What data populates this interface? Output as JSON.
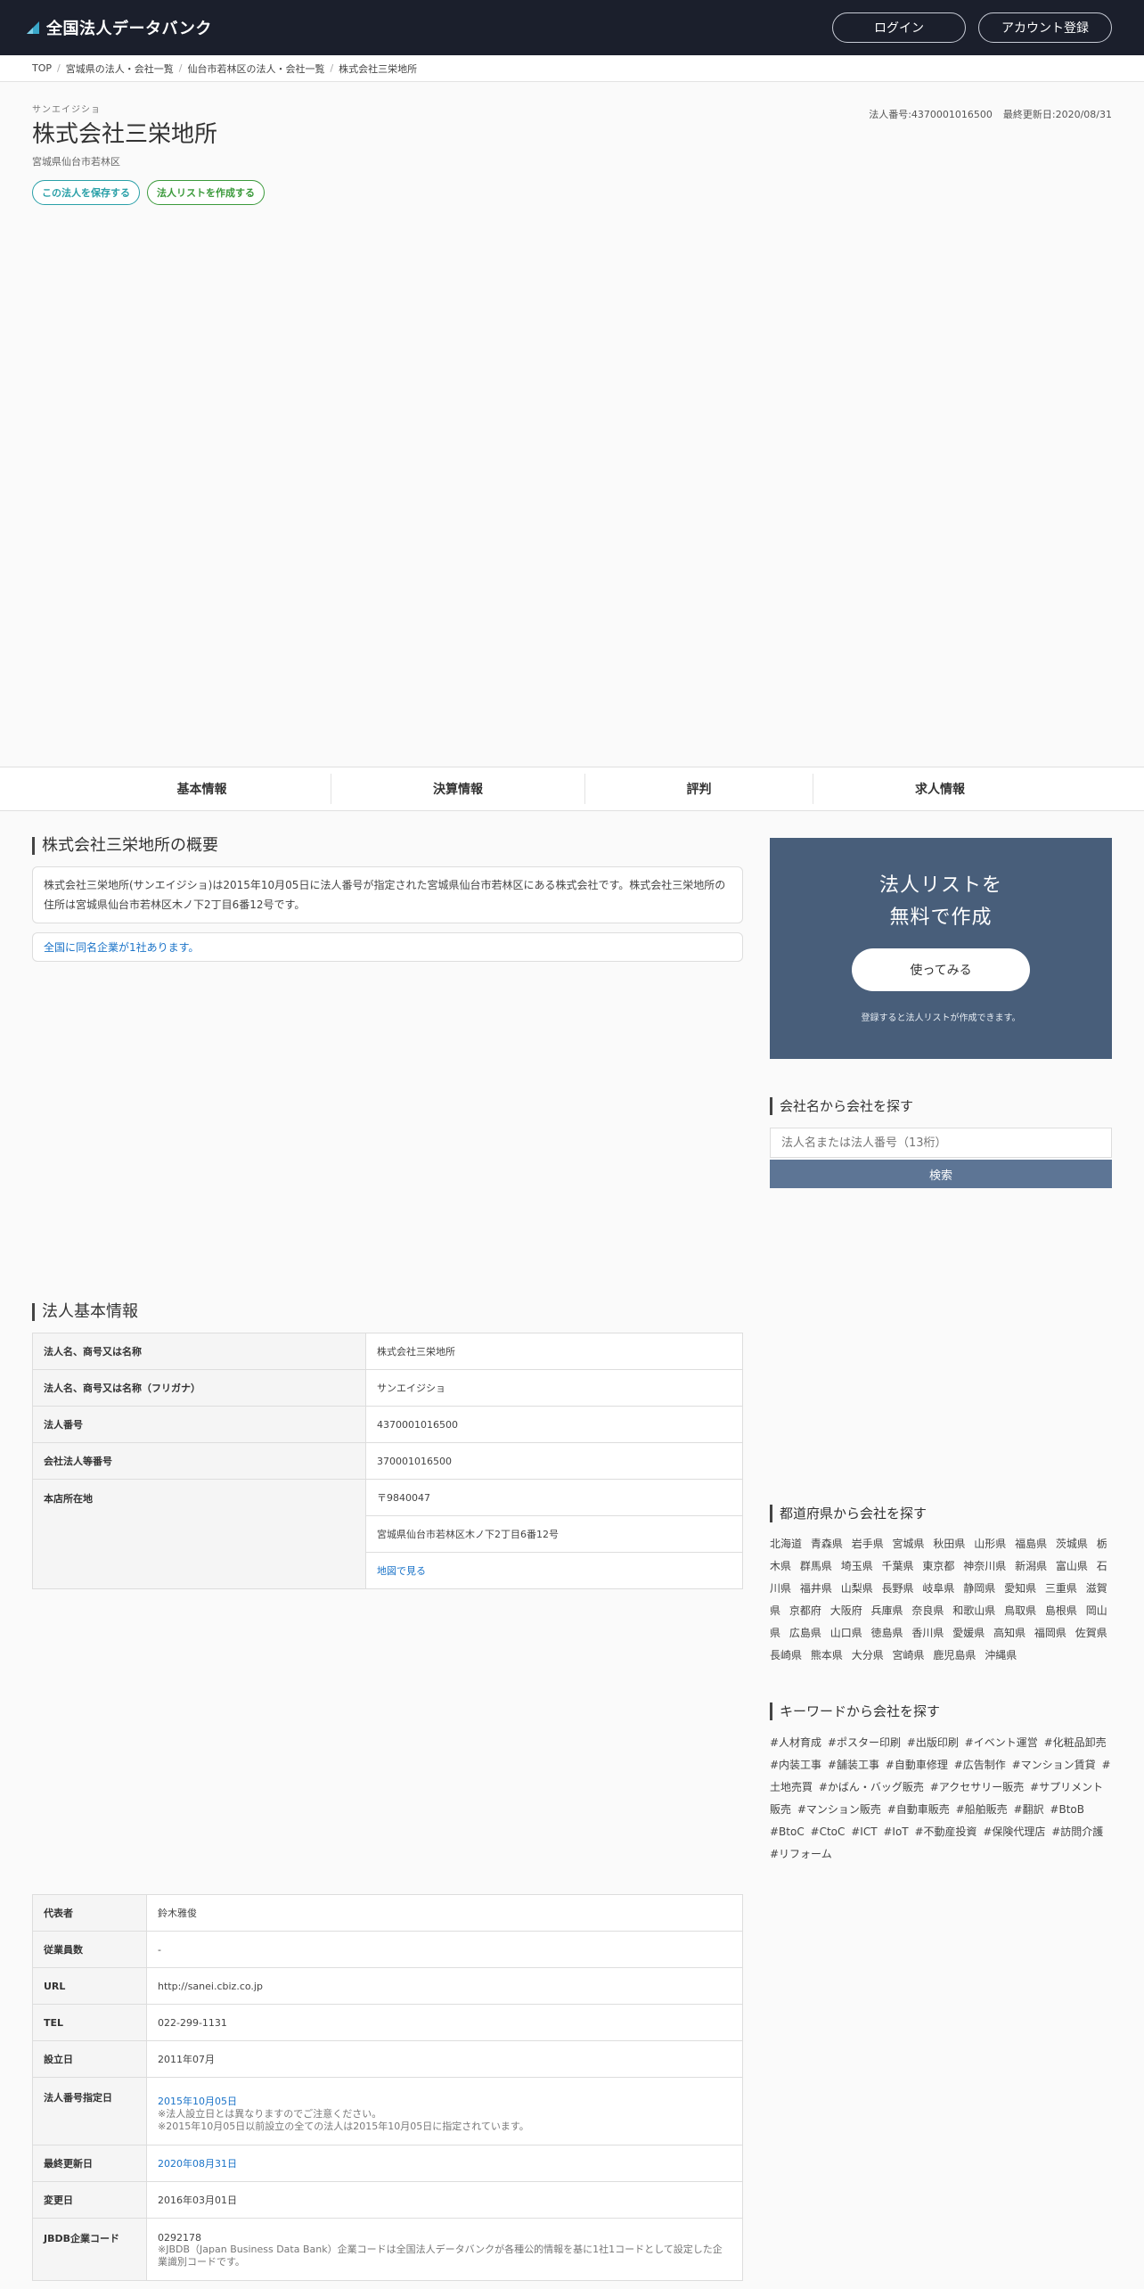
{
  "header": {
    "logo_text": "全国法人データバンク",
    "login_label": "ログイン",
    "signup_label": "アカウント登録"
  },
  "breadcrumb": [
    "TOP",
    "宮城県の法人・会社一覧",
    "仙台市若林区の法人・会社一覧",
    "株式会社三栄地所"
  ],
  "company": {
    "kana": "サンエイジショ",
    "name": "株式会社三栄地所",
    "address_short": "宮城県仙台市若林区",
    "corp_number_label": "法人番号:4370001016500",
    "updated_label": "最終更新日:2020/08/31",
    "save_button": "この法人を保存する",
    "list_button": "法人リストを作成する"
  },
  "tabs": [
    "基本情報",
    "決算情報",
    "評判",
    "求人情報"
  ],
  "overview": {
    "title": "株式会社三栄地所の概要",
    "text": "株式会社三栄地所(サンエイジショ)は2015年10月05日に法人番号が指定された宮城県仙台市若林区にある株式会社です。株式会社三栄地所の住所は宮城県仙台市若林区木ノ下2丁目6番12号です。",
    "same_name_note": "全国に同名企業が1社あります。"
  },
  "basic_info": {
    "title": "法人基本情報",
    "rows": [
      {
        "key": "法人名、商号又は名称",
        "value": "株式会社三栄地所"
      },
      {
        "key": "法人名、商号又は名称（フリガナ）",
        "value": "サンエイジショ"
      },
      {
        "key": "法人番号",
        "value": "4370001016500"
      },
      {
        "key": "会社法人等番号",
        "value": "370001016500"
      }
    ],
    "address_key": "本店所在地",
    "postal": "〒9840047",
    "address_full": "宮城県仙台市若林区木ノ下2丁目6番12号",
    "map_link": "地図で見る"
  },
  "detail_info": {
    "rows": [
      {
        "key": "代表者",
        "value": "鈴木雅俊"
      },
      {
        "key": "従業員数",
        "value": "-"
      },
      {
        "key": "URL",
        "value": "http://sanei.cbiz.co.jp"
      },
      {
        "key": "TEL",
        "value": "022-299-1131"
      },
      {
        "key": "設立日",
        "value": "2011年07月"
      }
    ],
    "designation_key": "法人番号指定日",
    "designation_date": "2015年10月05日",
    "designation_note1": "※法人設立日とは異なりますのでご注意ください。",
    "designation_note2": "※2015年10月05日以前設立の全ての法人は2015年10月05日に指定されています。",
    "updated_key": "最終更新日",
    "updated_value": "2020年08月31日",
    "changed_key": "変更日",
    "changed_value": "2016年03月01日",
    "jbdb_key": "JBDB企業コード",
    "jbdb_value": "0292178",
    "jbdb_note": "※JBDB（Japan Business Data Bank）企業コードは全国法人データバンクが各種公的情報を基に1社1コードとして設定した企業識別コードです。"
  },
  "sidebar": {
    "promo_line1": "法人リストを",
    "promo_line2": "無料で作成",
    "promo_button": "使ってみる",
    "promo_note": "登録すると法人リストが作成できます。",
    "search_title": "会社名から会社を探す",
    "search_placeholder": "法人名または法人番号（13桁）",
    "search_button": "検索",
    "pref_title": "都道府県から会社を探す",
    "prefectures": [
      "北海道",
      "青森県",
      "岩手県",
      "宮城県",
      "秋田県",
      "山形県",
      "福島県",
      "茨城県",
      "栃木県",
      "群馬県",
      "埼玉県",
      "千葉県",
      "東京都",
      "神奈川県",
      "新潟県",
      "富山県",
      "石川県",
      "福井県",
      "山梨県",
      "長野県",
      "岐阜県",
      "静岡県",
      "愛知県",
      "三重県",
      "滋賀県",
      "京都府",
      "大阪府",
      "兵庫県",
      "奈良県",
      "和歌山県",
      "鳥取県",
      "島根県",
      "岡山県",
      "広島県",
      "山口県",
      "徳島県",
      "香川県",
      "愛媛県",
      "高知県",
      "福岡県",
      "佐賀県",
      "長崎県",
      "熊本県",
      "大分県",
      "宮崎県",
      "鹿児島県",
      "沖縄県"
    ],
    "keyword_title": "キーワードから会社を探す",
    "keywords": [
      "#人材育成",
      "#ポスター印刷",
      "#出版印刷",
      "#イベント運営",
      "#化粧品卸売",
      "#内装工事",
      "#舗装工事",
      "#自動車修理",
      "#広告制作",
      "#マンション賃貸",
      "#土地売買",
      "#かばん・バッグ販売",
      "#アクセサリー販売",
      "#サプリメント販売",
      "#マンション販売",
      "#自動車販売",
      "#船舶販売",
      "#翻訳",
      "#BtoB",
      "#BtoC",
      "#CtoC",
      "#ICT",
      "#IoT",
      "#不動産投資",
      "#保険代理店",
      "#訪問介護",
      "#リフォーム"
    ]
  },
  "colors": {
    "header_bg": "#1b1f2c",
    "promo_bg": "#485e7a",
    "search_button_bg": "#5d7595",
    "link": "#1a73c8"
  }
}
